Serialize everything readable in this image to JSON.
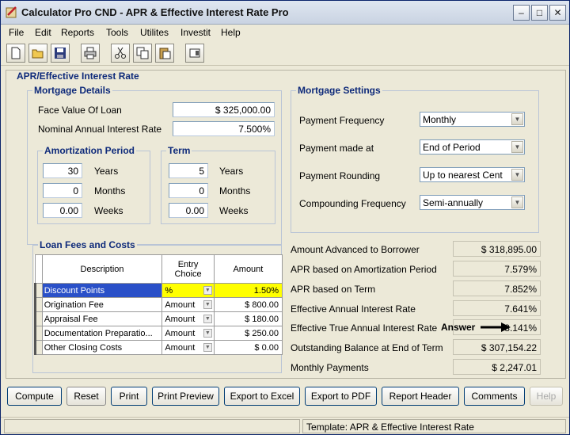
{
  "window": {
    "title": "Calculator Pro CND - APR & Effective Interest Rate Pro"
  },
  "menu": [
    "File",
    "Edit",
    "Reports",
    "Tools",
    "Utilites",
    "Investit",
    "Help"
  ],
  "toolbar": [
    "new-icon",
    "open-icon",
    "save-icon",
    "print-icon",
    "cut-icon",
    "copy-icon",
    "paste-icon",
    "calculator-icon"
  ],
  "panel_title": "APR/Effective Interest Rate",
  "mortgage_details": {
    "title": "Mortgage Details",
    "face_value_label": "Face Value Of Loan",
    "face_value": "$ 325,000.00",
    "rate_label": "Nominal Annual Interest Rate",
    "rate": "7.500%"
  },
  "amortization": {
    "title": "Amortization Period",
    "years": "30",
    "months": "0",
    "weeks": "0.00",
    "years_label": "Years",
    "months_label": "Months",
    "weeks_label": "Weeks"
  },
  "term": {
    "title": "Term",
    "years": "5",
    "months": "0",
    "weeks": "0.00",
    "years_label": "Years",
    "months_label": "Months",
    "weeks_label": "Weeks"
  },
  "settings": {
    "title": "Mortgage Settings",
    "payment_frequency_label": "Payment Frequency",
    "payment_frequency": "Monthly",
    "payment_made_label": "Payment made at",
    "payment_made": "End of Period",
    "rounding_label": "Payment Rounding",
    "rounding": "Up to nearest Cent",
    "compounding_label": "Compounding Frequency",
    "compounding": "Semi-annually"
  },
  "fees": {
    "title": "Loan Fees and Costs",
    "headers": {
      "description": "Description",
      "entry1": "Entry",
      "entry2": "Choice",
      "amount": "Amount"
    },
    "rows": [
      {
        "desc": "Discount Points",
        "choice": "%",
        "amount": "1.50%"
      },
      {
        "desc": "Origination Fee",
        "choice": "Amount",
        "amount": "$ 800.00"
      },
      {
        "desc": "Appraisal Fee",
        "choice": "Amount",
        "amount": "$ 180.00"
      },
      {
        "desc": "Documentation Preparatio...",
        "choice": "Amount",
        "amount": "$ 250.00"
      },
      {
        "desc": "Other Closing Costs",
        "choice": "Amount",
        "amount": "$ 0.00"
      }
    ]
  },
  "results": {
    "advanced_label": "Amount Advanced to Borrower",
    "advanced": "$ 318,895.00",
    "apr_amort_label": "APR based on Amortization Period",
    "apr_amort": "7.579%",
    "apr_term_label": "APR based on Term",
    "apr_term": "7.852%",
    "effective_label": "Effective Annual Interest Rate",
    "effective": "7.641%",
    "true_label": "Effective True Annual Interest Rate",
    "true_rate": "8.141%",
    "answer_label": "Answer",
    "balance_label": "Outstanding Balance at End of Term",
    "balance": "$ 307,154.22",
    "monthly_label": "Monthly Payments",
    "monthly": "$ 2,247.01"
  },
  "buttons": {
    "compute": "Compute",
    "reset": "Reset",
    "print": "Print",
    "preview": "Print Preview",
    "excel": "Export to Excel",
    "pdf": "Export to PDF",
    "header": "Report Header",
    "comments": "Comments",
    "help": "Help"
  },
  "status": {
    "template": "Template: APR & Effective Interest Rate"
  }
}
